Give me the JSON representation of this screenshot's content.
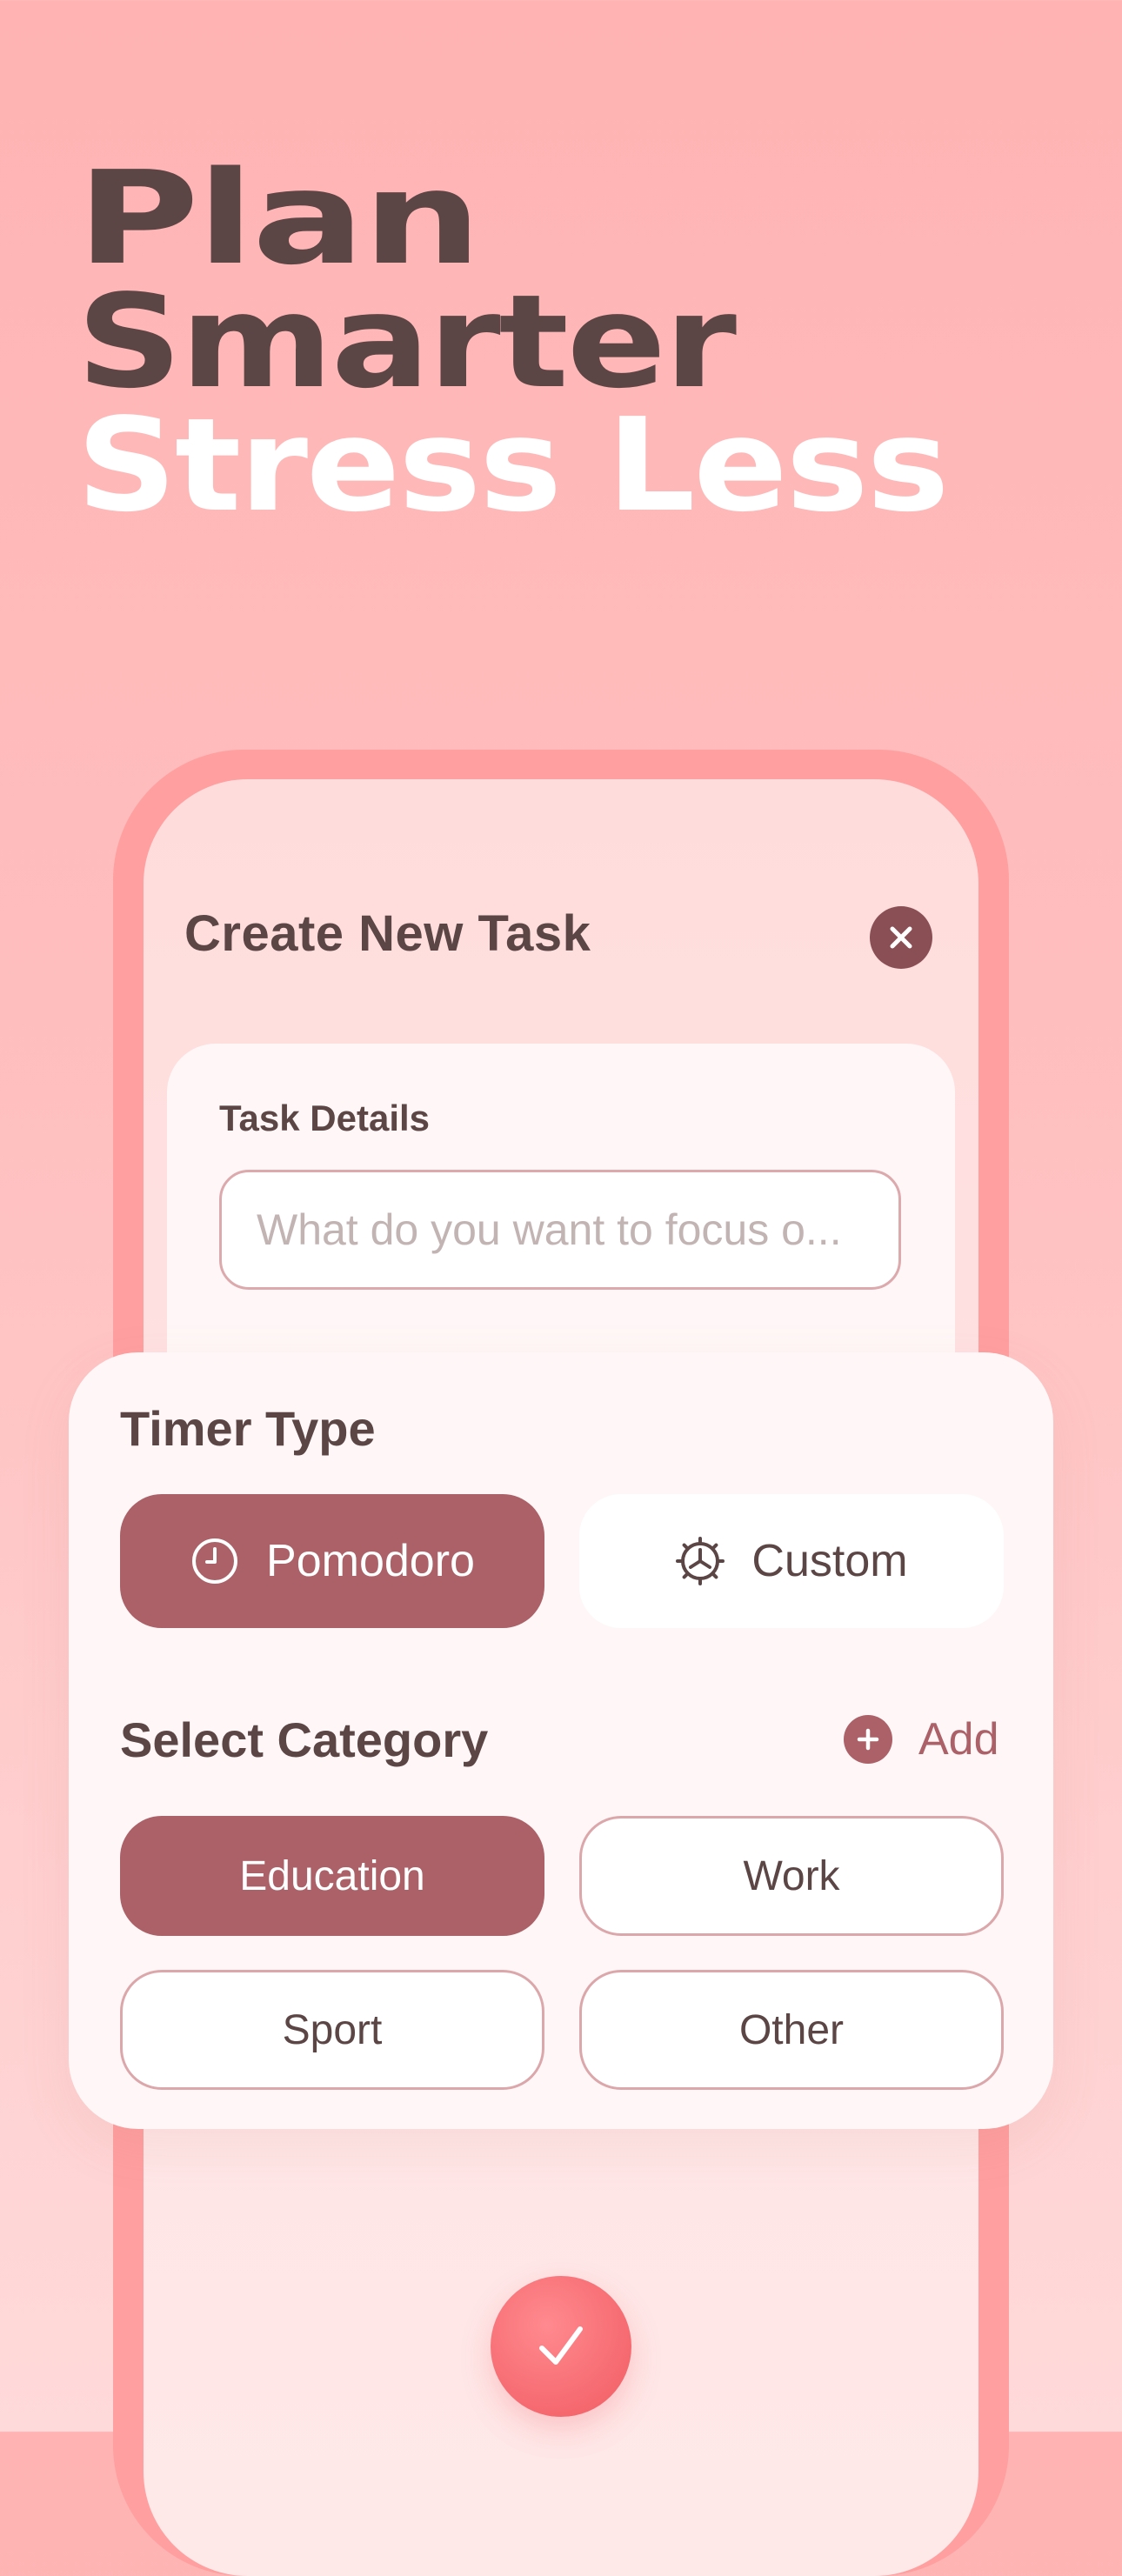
{
  "headline": {
    "line1": "Plan",
    "line2": "Smarter",
    "line3": "Stress Less"
  },
  "modal": {
    "title": "Create New Task",
    "close_icon": "close-icon"
  },
  "task_details": {
    "label": "Task Details",
    "placeholder": "What do you want to focus o...",
    "value": ""
  },
  "timer_type": {
    "title": "Timer Type",
    "selected": "Pomodoro",
    "options": [
      {
        "label": "Pomodoro",
        "icon": "clock-icon"
      },
      {
        "label": "Custom",
        "icon": "gear-icon"
      }
    ]
  },
  "category": {
    "title": "Select Category",
    "add_label": "Add",
    "add_icon": "plus-icon",
    "selected": "Education",
    "options": [
      {
        "label": "Education"
      },
      {
        "label": "Work"
      },
      {
        "label": "Sport"
      },
      {
        "label": "Other"
      }
    ]
  },
  "confirm": {
    "icon": "checkmark-icon"
  },
  "colors": {
    "background_top": "#ffb3b3",
    "background_bottom": "#ffdada",
    "heading_dark": "#5c4545",
    "accent": "#ab6167",
    "close_button": "#8a4f55",
    "confirm_button": "#f5696f",
    "phone_frame": "#ff9f9f"
  }
}
